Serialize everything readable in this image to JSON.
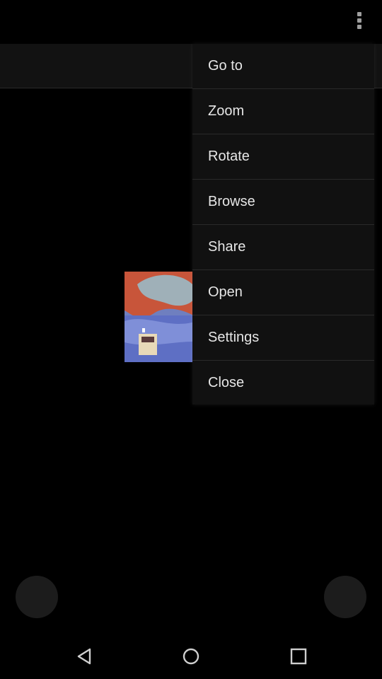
{
  "menu": {
    "items": [
      {
        "label": "Go to"
      },
      {
        "label": "Zoom"
      },
      {
        "label": "Rotate"
      },
      {
        "label": "Browse"
      },
      {
        "label": "Share"
      },
      {
        "label": "Open"
      },
      {
        "label": "Settings"
      },
      {
        "label": "Close"
      }
    ]
  },
  "icons": {
    "overflow": "more-vertical-icon",
    "back": "back-triangle-icon",
    "home": "home-circle-icon",
    "recents": "recents-square-icon"
  },
  "colors": {
    "background": "#000000",
    "menu_background": "#111111",
    "menu_text": "#e6e6e6",
    "divider": "#2a2a2a"
  }
}
